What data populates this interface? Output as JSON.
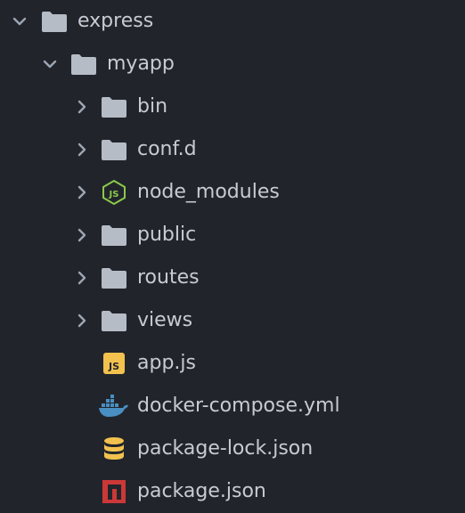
{
  "tree": {
    "root": {
      "label": "express",
      "icon": "folder-icon",
      "expanded": true
    },
    "project": {
      "label": "myapp",
      "icon": "folder-icon",
      "expanded": true
    },
    "folders": [
      {
        "label": "bin",
        "icon": "folder-icon"
      },
      {
        "label": "conf.d",
        "icon": "folder-icon"
      },
      {
        "label": "node_modules",
        "icon": "nodejs-icon"
      },
      {
        "label": "public",
        "icon": "folder-icon"
      },
      {
        "label": "routes",
        "icon": "folder-icon"
      },
      {
        "label": "views",
        "icon": "folder-icon"
      }
    ],
    "files": [
      {
        "label": "app.js",
        "icon": "javascript-icon"
      },
      {
        "label": "docker-compose.yml",
        "icon": "docker-icon"
      },
      {
        "label": "package-lock.json",
        "icon": "database-icon"
      },
      {
        "label": "package.json",
        "icon": "npm-icon"
      }
    ]
  },
  "colors": {
    "background": "#21252b",
    "text": "#c6cbd4",
    "folder": "#b6bcc6",
    "chevron": "#9da5b4",
    "nodejs": "#8cc84b",
    "javascript": "#f2c14e",
    "docker": "#4a8fc2",
    "database": "#f2c14e",
    "npm": "#cb3837"
  }
}
